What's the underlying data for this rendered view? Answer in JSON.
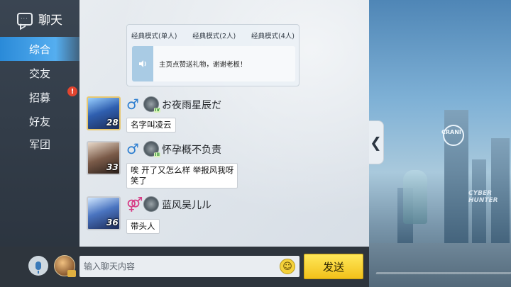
{
  "sidebar": {
    "title": "聊天",
    "items": [
      {
        "label": "综合",
        "active": true
      },
      {
        "label": "交友",
        "active": false
      },
      {
        "label": "招募",
        "active": false,
        "badge": "!"
      },
      {
        "label": "好友",
        "active": false
      },
      {
        "label": "军团",
        "active": false
      }
    ]
  },
  "pinned": {
    "tabs": [
      "经典模式(单人)",
      "经典模式(2人)",
      "经典模式(4人)"
    ],
    "message": "主页点赞送礼物，谢谢老板！"
  },
  "messages": [
    {
      "level": "28",
      "gender": "♂",
      "name": "お夜雨星辰だ",
      "text": "名字叫凌云"
    },
    {
      "level": "33",
      "gender": "♂",
      "name": "怀孕概不负责",
      "text_lines": [
        "唉 开了又怎么样 举报风我呀",
        "笑了"
      ]
    },
    {
      "level": "36",
      "gender": "⚤",
      "name": "蓝风吴儿ル",
      "text": "带头人"
    }
  ],
  "input": {
    "placeholder": "输入聊天内容"
  },
  "send_label": "发送",
  "collapse_glyph": "❮",
  "scene": {
    "sign": "CRANI",
    "logo_lines": [
      "CYBER",
      "HUNTER"
    ]
  },
  "colors": {
    "accent": "#3a9be6",
    "send": "#f6d02c",
    "badge": "#e2452f"
  }
}
